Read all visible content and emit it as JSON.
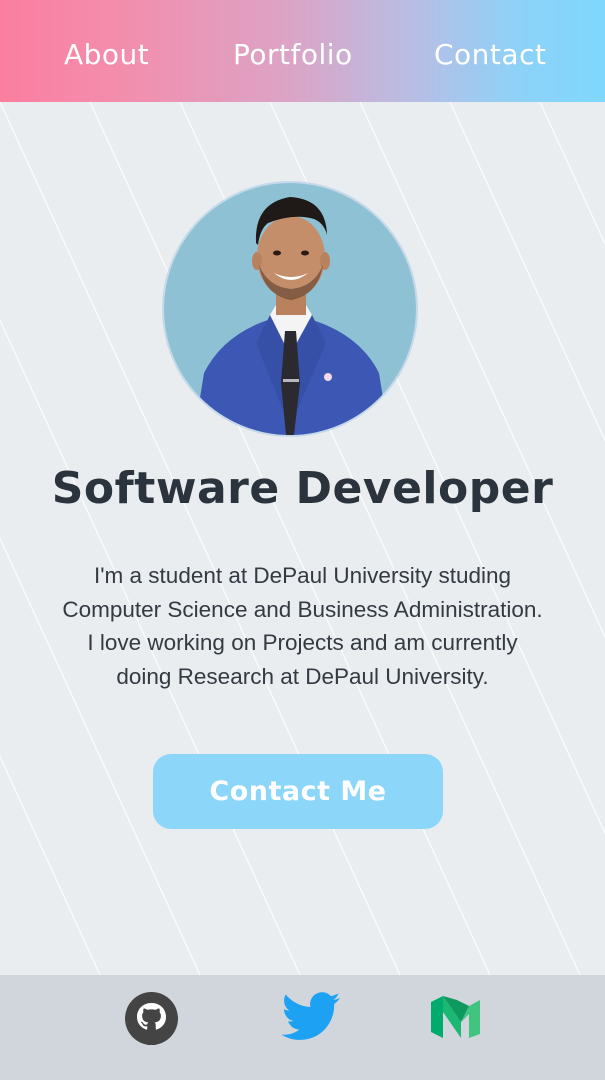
{
  "nav": {
    "items": [
      {
        "label": "About"
      },
      {
        "label": "Portfolio"
      },
      {
        "label": "Contact"
      }
    ]
  },
  "hero": {
    "avatar": {
      "icon": "profile-photo"
    },
    "title": "Software Developer",
    "bio_lines": [
      "I'm a student at DePaul University studing",
      "Computer Science and Business Administration.",
      "I love working on Projects and am currently",
      "doing Research at DePaul University."
    ],
    "cta_label": "Contact Me"
  },
  "footer": {
    "links": [
      {
        "name": "github",
        "icon": "github-icon"
      },
      {
        "name": "twitter",
        "icon": "twitter-icon"
      },
      {
        "name": "medium",
        "icon": "medium-icon"
      }
    ]
  },
  "colors": {
    "nav_gradient_start": "#fb7ea0",
    "nav_gradient_end": "#7fd7fd",
    "background": "#e9edf0",
    "cta": "#8cd6f9",
    "title": "#2b343c",
    "footer": "#d0d6dc",
    "twitter": "#1da1f2",
    "medium": "#19b36b"
  }
}
